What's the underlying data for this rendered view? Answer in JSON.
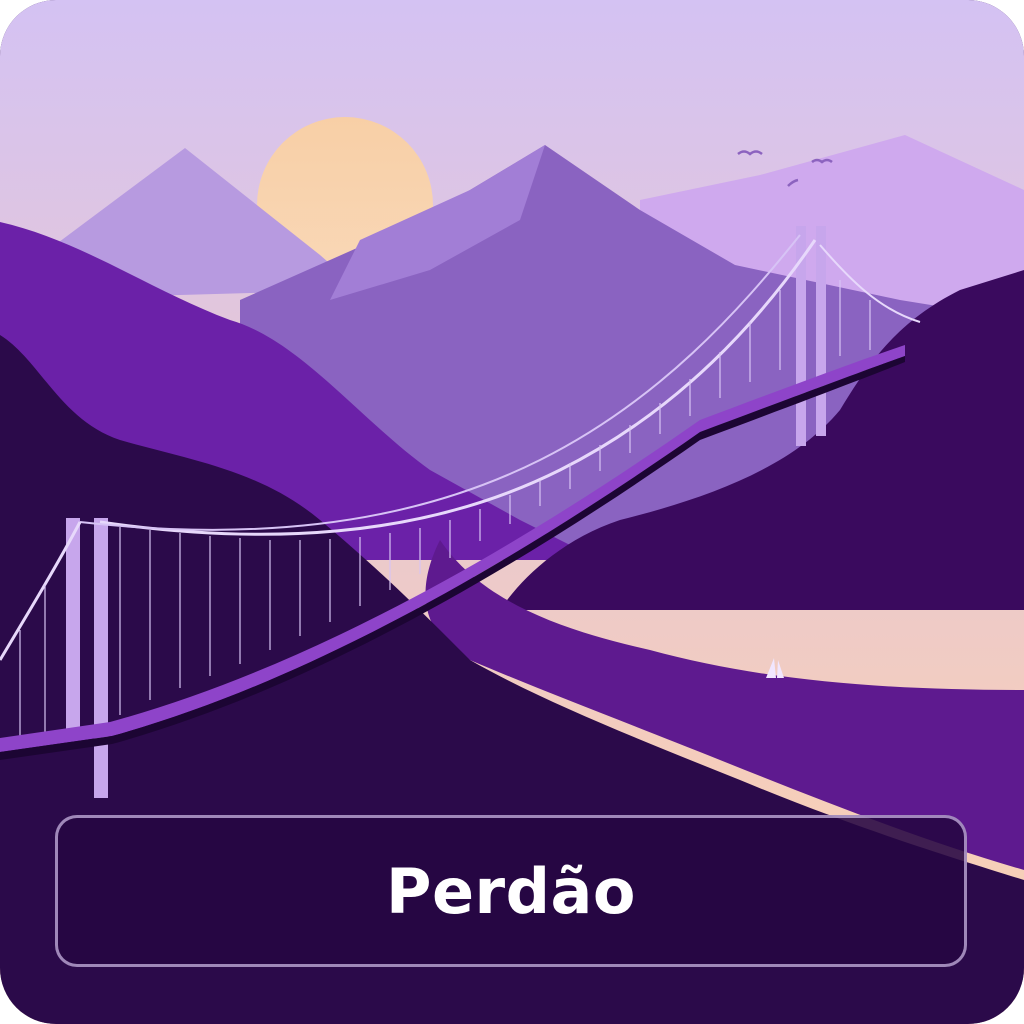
{
  "card": {
    "label": "Perdão",
    "illustration_icon": "bridge-over-valley-icon"
  },
  "colors": {
    "sky_top": "#d6c3f2",
    "sky_bottom": "#f6cdb9",
    "sun": "#f8d4a8",
    "panel_background": "#260642",
    "panel_border": "#c8b4e1",
    "label_text": "#ffffff",
    "bridge": "#c9a4ec"
  }
}
